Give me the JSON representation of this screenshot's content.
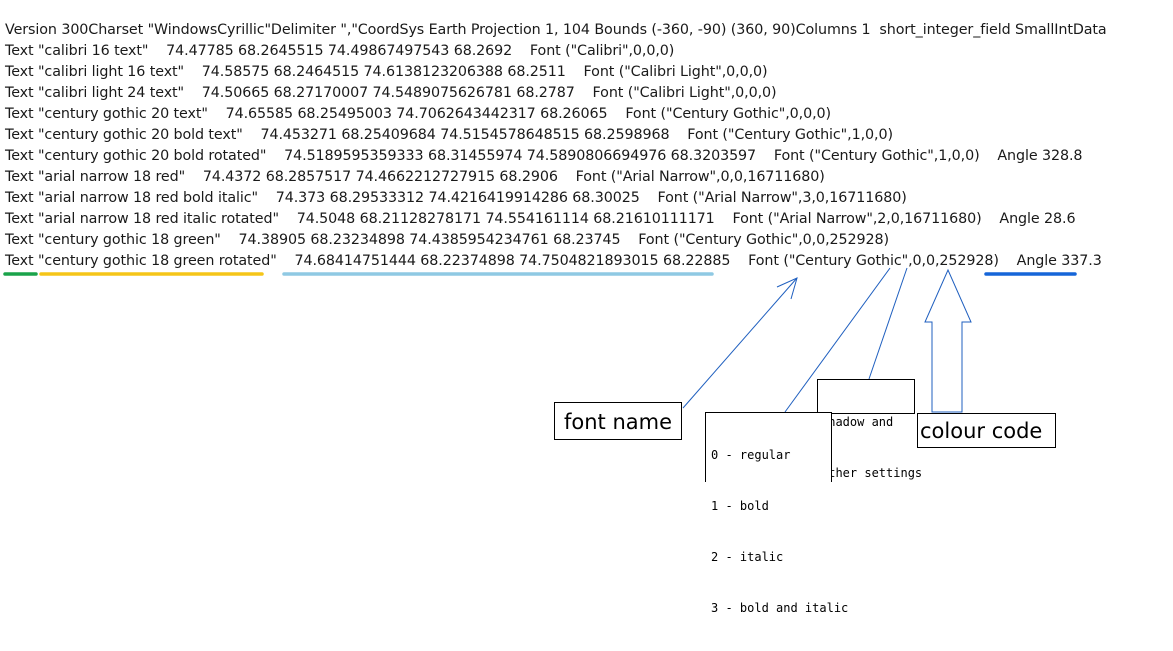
{
  "text_lines": [
    "Version 300Charset \"WindowsCyrillic\"Delimiter \",\"CoordSys Earth Projection 1, 104 Bounds (-360, -90) (360, 90)Columns 1  short_integer_field SmallIntData",
    "Text \"calibri 16 text\"    74.47785 68.2645515 74.49867497543 68.2692    Font (\"Calibri\",0,0,0)",
    "Text \"calibri light 16 text\"    74.58575 68.2464515 74.6138123206388 68.2511    Font (\"Calibri Light\",0,0,0)",
    "Text \"calibri light 24 text\"    74.50665 68.27170007 74.5489075626781 68.2787    Font (\"Calibri Light\",0,0,0)",
    "Text \"century gothic 20 text\"    74.65585 68.25495003 74.7062643442317 68.26065    Font (\"Century Gothic\",0,0,0)",
    "Text \"century gothic 20 bold text\"    74.453271 68.25409684 74.5154578648515 68.2598968    Font (\"Century Gothic\",1,0,0)",
    "Text \"century gothic 20 bold rotated\"    74.5189595359333 68.31455974 74.5890806694976 68.3203597    Font (\"Century Gothic\",1,0,0)    Angle 328.8",
    "Text \"arial narrow 18 red\"    74.4372 68.2857517 74.4662212727915 68.2906    Font (\"Arial Narrow\",0,0,16711680)",
    "Text \"arial narrow 18 red bold italic\"    74.373 68.29533312 74.4216419914286 68.30025    Font (\"Arial Narrow\",3,0,16711680)",
    "Text \"arial narrow 18 red italic rotated\"    74.5048 68.21128278171 74.554161114 68.21610111171    Font (\"Arial Narrow\",2,0,16711680)    Angle 28.6",
    "Text \"century gothic 18 green\"    74.38905 68.23234898 74.4385954234761 68.23745    Font (\"Century Gothic\",0,0,252928)",
    "Text \"century gothic 18 green rotated\"    74.68414751444 68.22374898 74.7504821893015 68.22885    Font (\"Century Gothic\",0,0,252928)    Angle 337.3"
  ],
  "annotations": {
    "font_name": "font name",
    "style_codes": [
      "0 - regular",
      "1 - bold",
      "2 - italic",
      "3 - bold and italic"
    ],
    "shadow_settings": [
      "shadow and",
      "other settings"
    ],
    "colour_code": "colour code"
  },
  "colors": {
    "underline_keyword": "#1aa34a",
    "underline_text": "#f5c518",
    "underline_coords": "#8fc9e3",
    "underline_angle": "#1565d8",
    "arrow": "#1f5fbf"
  }
}
